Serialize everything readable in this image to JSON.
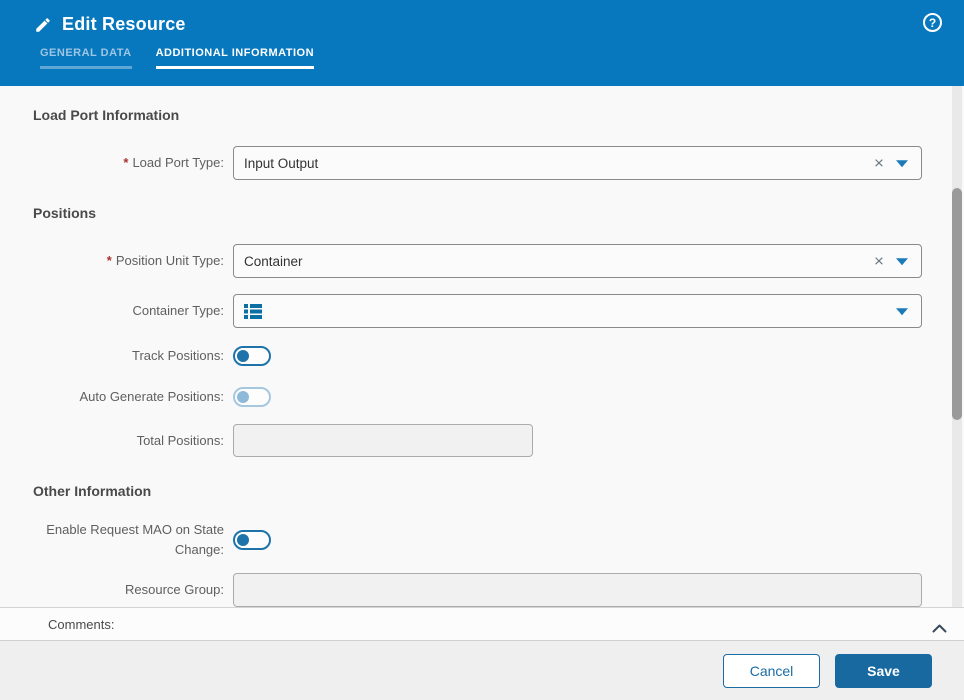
{
  "header": {
    "title": "Edit Resource",
    "help_symbol": "?",
    "tabs": [
      {
        "label": "GENERAL DATA",
        "active": false
      },
      {
        "label": "ADDITIONAL INFORMATION",
        "active": true
      }
    ]
  },
  "form": {
    "required_marker": "*",
    "sections": {
      "load_port": {
        "title": "Load Port Information"
      },
      "positions": {
        "title": "Positions"
      },
      "other": {
        "title": "Other Information"
      }
    },
    "fields": {
      "load_port_type": {
        "label": "Load Port Type:",
        "value": "Input Output",
        "required": true
      },
      "position_unit_type": {
        "label": "Position Unit Type:",
        "value": "Container",
        "required": true
      },
      "container_type": {
        "label": "Container Type:",
        "selected_icon": "list-icon"
      },
      "track_positions": {
        "label": "Track Positions:",
        "state": "off",
        "enabled": true
      },
      "auto_generate_positions": {
        "label": "Auto Generate Positions:",
        "state": "off",
        "enabled": false
      },
      "total_positions": {
        "label": "Total Positions:",
        "value": ""
      },
      "enable_request_mao": {
        "label": "Enable Request MAO on State Change:",
        "state": "off",
        "enabled": true
      },
      "resource_group": {
        "label": "Resource Group:",
        "value": ""
      }
    }
  },
  "comments": {
    "label": "Comments:"
  },
  "footer": {
    "cancel_label": "Cancel",
    "save_label": "Save"
  },
  "icons": {
    "clear": "×"
  },
  "colors": {
    "header_blue": "#0878be",
    "primary_blue": "#1b6ca3",
    "caret_blue": "#1d7ab8",
    "toggle_blue": "#1e74aa",
    "required_red": "#a8342f",
    "scroll_thumb": "#9a9a9a"
  }
}
